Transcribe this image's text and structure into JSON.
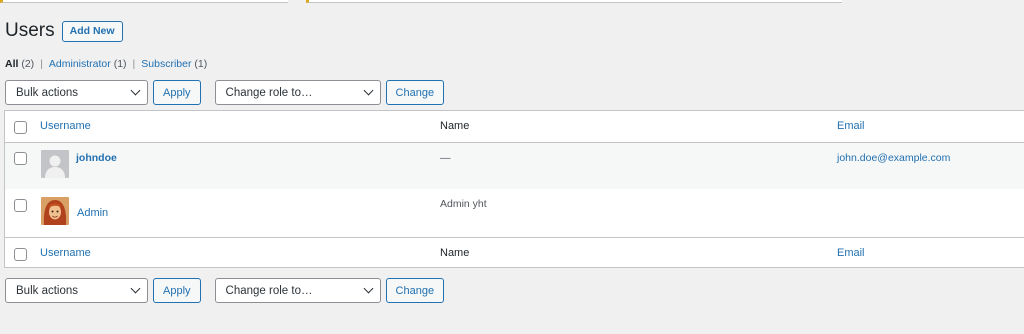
{
  "header": {
    "title": "Users",
    "add_new": "Add New"
  },
  "views": [
    {
      "label": "All",
      "count": "(2)"
    },
    {
      "label": "Administrator",
      "count": "(1)"
    },
    {
      "label": "Subscriber",
      "count": "(1)"
    }
  ],
  "views_sep": "|",
  "tablenav": {
    "bulk_actions": "Bulk actions",
    "apply": "Apply",
    "change_role": "Change role to…",
    "change": "Change"
  },
  "columns": {
    "username": "Username",
    "name": "Name",
    "email": "Email"
  },
  "rows": [
    {
      "username": "johndoe",
      "name": "—",
      "email": "john.doe@example.com",
      "avatar": "default-avatar-icon"
    },
    {
      "username": "Admin",
      "name": "Admin yht",
      "email": "",
      "avatar": "user-photo-avatar"
    }
  ],
  "colors": {
    "link": "#2271b1",
    "background": "#f0f0f1",
    "warning": "#dba617"
  }
}
